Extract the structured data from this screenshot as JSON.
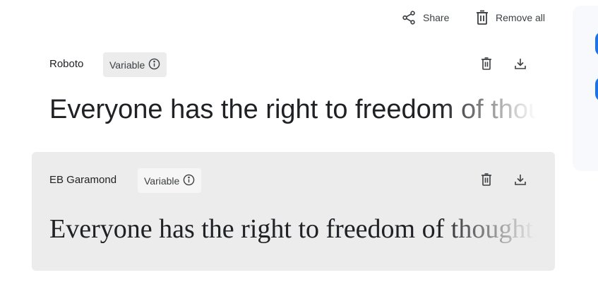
{
  "toolbar": {
    "share_label": "Share",
    "remove_all_label": "Remove all"
  },
  "fonts": [
    {
      "name": "Roboto",
      "badge": "Variable",
      "preview": "Everyone has the right to freedom of thought, conscience and religion"
    },
    {
      "name": "EB Garamond",
      "badge": "Variable",
      "preview": "Everyone has the right to freedom of thought, conscience and religion"
    }
  ],
  "colors": {
    "accent": "#1a73e8",
    "selected_card_bg": "#ececec",
    "icon": "#3c4043"
  },
  "icons": {
    "share": "share-icon",
    "remove_all": "trash-icon",
    "info": "info-icon",
    "delete": "trash-icon",
    "download": "download-icon"
  }
}
